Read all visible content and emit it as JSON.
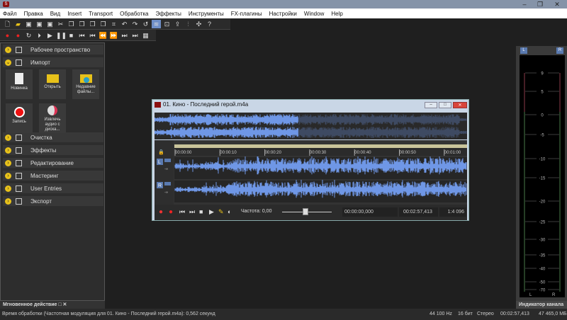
{
  "menu": [
    "Файл",
    "Правка",
    "Вид",
    "Insert",
    "Transport",
    "Обработка",
    "Эффекты",
    "Инструменты",
    "FX-плагины",
    "Настройки",
    "Window",
    "Help"
  ],
  "toolbar1": [
    "new-file",
    "open",
    "save",
    "save-as",
    "save-all",
    "cut",
    "copy",
    "paste",
    "paste-mix",
    "paste-new",
    "crop",
    "undo",
    "redo",
    "repeat",
    "wave-edit",
    "zoom-view",
    "export",
    "split",
    "fx",
    "help"
  ],
  "toolbar2": [
    "record-settings",
    "record",
    "loop",
    "play-selection",
    "play",
    "pause",
    "stop",
    "go-start",
    "prev-marker",
    "rewind",
    "fast-forward",
    "next-marker",
    "go-end",
    "snapshot"
  ],
  "sidebar": {
    "sections": [
      {
        "label": "Рабочее пространство",
        "expanded": false
      },
      {
        "label": "Импорт",
        "expanded": true
      },
      {
        "label": "Очистка",
        "expanded": false
      },
      {
        "label": "Эффекты",
        "expanded": false
      },
      {
        "label": "Редактирование",
        "expanded": false
      },
      {
        "label": "Мастеринг",
        "expanded": false
      },
      {
        "label": "User Entries",
        "expanded": false
      },
      {
        "label": "Экспорт",
        "expanded": false
      }
    ],
    "tiles": [
      {
        "label": "Новинка"
      },
      {
        "label": "Открыть"
      },
      {
        "label": "Недавние файлы..."
      },
      {
        "label": "Запись"
      },
      {
        "label": "Извлечь аудио с диска..."
      }
    ]
  },
  "audio_window": {
    "title": "01. Кино - Последний герой.m4a",
    "ruler": [
      "00:00:00",
      "00:00:10",
      "00:00:20",
      "00:00:30",
      "00:00:40",
      "00:00:50",
      "00:01:00"
    ],
    "channels": [
      "L",
      "R"
    ],
    "channel_db": "-∞",
    "frequency": "Частота: 0,00",
    "position": "00:00:00,000",
    "duration": "00:02:57,413",
    "zoom": "1:4 096",
    "overview_played_fraction": 0.46,
    "wave_color": "#6f97e6"
  },
  "meter": {
    "title": "Индикатор канала",
    "left": "L",
    "right": "R",
    "scale": [
      "9",
      "5",
      "0",
      "-5",
      "-10",
      "-15",
      "-20",
      "-25",
      "-30",
      "-35",
      "-40",
      "-50",
      "-70"
    ]
  },
  "bottom_tab": {
    "label": "Мгновенное действие"
  },
  "status": {
    "message": "Время обработки (Частотная модуляция для 01. Кино - Последний герой.m4a): 0,562 секунд",
    "sample_rate": "44 100 Hz",
    "bit_depth": "16 бит",
    "channels": "Стерео",
    "length": "00:02:57,413",
    "size": "47 465,0 МБ"
  }
}
